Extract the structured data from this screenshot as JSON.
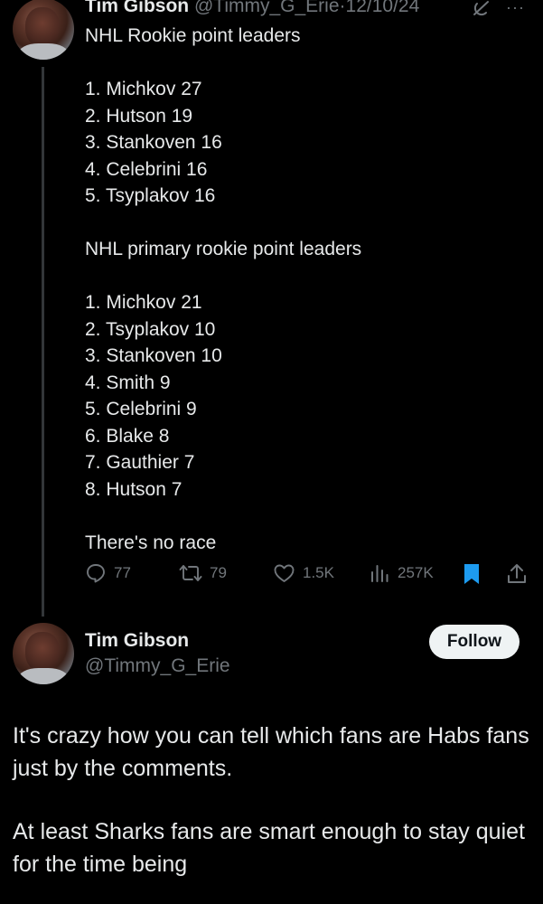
{
  "parent_tweet": {
    "author_name": "Tim Gibson",
    "author_handle": "@Timmy_G_Erie",
    "separator": "·",
    "date": "12/10/24",
    "more_label": "···",
    "lines": [
      "NHL Rookie point leaders",
      "",
      "1. Michkov 27",
      "2. Hutson 19",
      "3. Stankoven 16",
      "4. Celebrini 16",
      "5. Tsyplakov 16",
      "",
      "NHL primary rookie point leaders",
      "",
      "1. Michkov 21",
      "2. Tsyplakov 10",
      "3. Stankoven 10",
      "4. Smith 9",
      "5. Celebrini 9",
      "6. Blake 8",
      "7. Gauthier 7",
      "8. Hutson 7",
      "",
      "There's no race"
    ],
    "actions": {
      "replies": "77",
      "reposts": "79",
      "likes": "1.5K",
      "views": "257K"
    }
  },
  "reply": {
    "author_name": "Tim Gibson",
    "author_handle": "@Timmy_G_Erie",
    "follow_label": "Follow",
    "paragraphs": [
      "It's crazy how you can tell which fans are Habs fans just by the comments.",
      "At least Sharks fans are smart enough to stay quiet for the time being"
    ]
  },
  "colors": {
    "background": "#000000",
    "text": "#e7e9ea",
    "muted": "#71767b",
    "bookmark_active": "#1d9bf0",
    "follow_bg": "#eff3f4"
  },
  "icons": [
    "grok-icon",
    "more-icon",
    "reply-icon",
    "repost-icon",
    "like-icon",
    "views-icon",
    "bookmark-icon",
    "share-icon"
  ]
}
